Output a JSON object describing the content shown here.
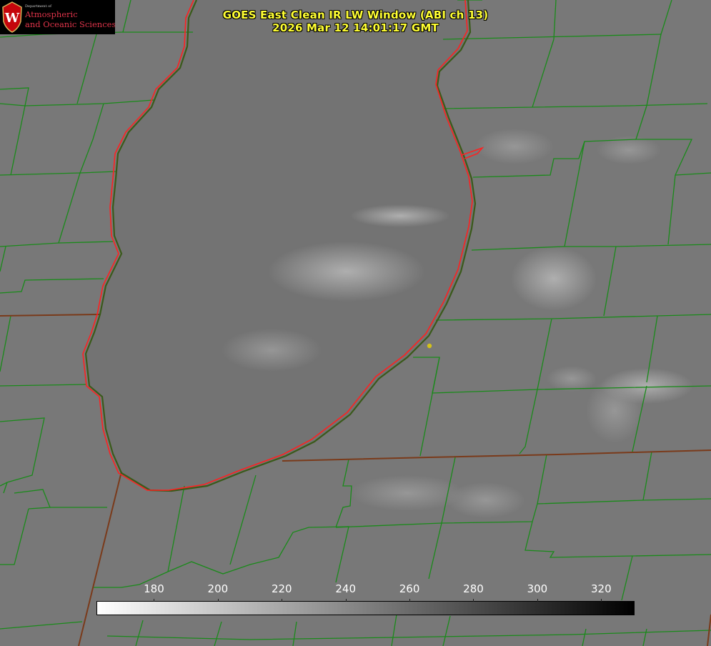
{
  "title": {
    "line1": "GOES East Clean IR LW Window (ABI ch 13)",
    "line2": "2026 Mar 12 14:01:17 GMT"
  },
  "logo": {
    "department": "Department of",
    "line1": "Atmospheric",
    "line2": "and Oceanic Sciences",
    "seal_letter": "W"
  },
  "colorbar": {
    "ticks": [
      "180",
      "200",
      "220",
      "240",
      "260",
      "280",
      "300",
      "320"
    ],
    "tick_values": [
      180,
      200,
      220,
      240,
      260,
      280,
      300,
      320
    ],
    "range": [
      162,
      330
    ],
    "gradient": [
      "#ffffff",
      "#000000"
    ]
  },
  "colors": {
    "background": "#7a7a7a",
    "lake": "#737373",
    "county_lines": "#1a8a1a",
    "state_coast": "#ff2020",
    "title_text": "#ffff33",
    "marker": "#d4c21a",
    "logo_red": "#e0344a"
  }
}
